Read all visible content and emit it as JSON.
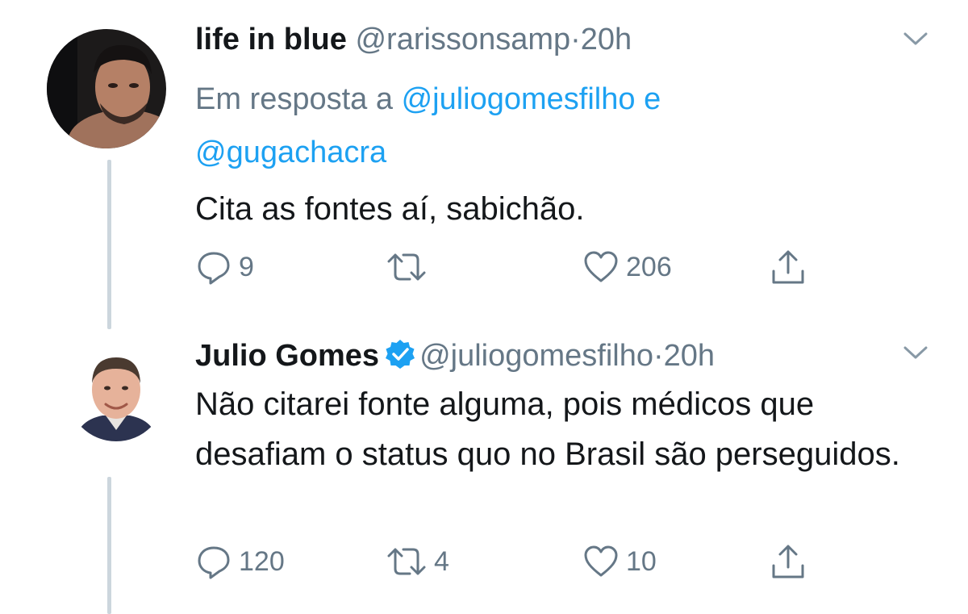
{
  "tweets": [
    {
      "name": "life in blue",
      "handle": "@rarissonsamp",
      "separator": "·",
      "time": "20h",
      "verified": false,
      "reply_prefix": "Em resposta a",
      "reply_mention_1": "@juliogomesfilho",
      "reply_joiner": "e",
      "reply_mention_2": "@gugachacra",
      "text": "Cita as fontes aí, sabichão.",
      "replies": "9",
      "retweets": "",
      "likes": "206"
    },
    {
      "name": "Julio Gomes",
      "handle": "@juliogomesfilho",
      "separator": "·",
      "time": "20h",
      "verified": true,
      "text": "Não citarei fonte alguma, pois médicos que desafiam o status quo no Brasil são perseguidos.",
      "replies": "120",
      "retweets": "4",
      "likes": "10"
    }
  ],
  "icons": {
    "reply": "reply-icon",
    "retweet": "retweet-icon",
    "like": "heart-icon",
    "share": "share-icon",
    "more": "chevron-down-icon",
    "verified": "verified-badge-icon"
  },
  "colors": {
    "link": "#1da1f2",
    "secondary_text": "#657786",
    "thread_line": "#ccd6dd",
    "verified": "#1da1f2"
  }
}
